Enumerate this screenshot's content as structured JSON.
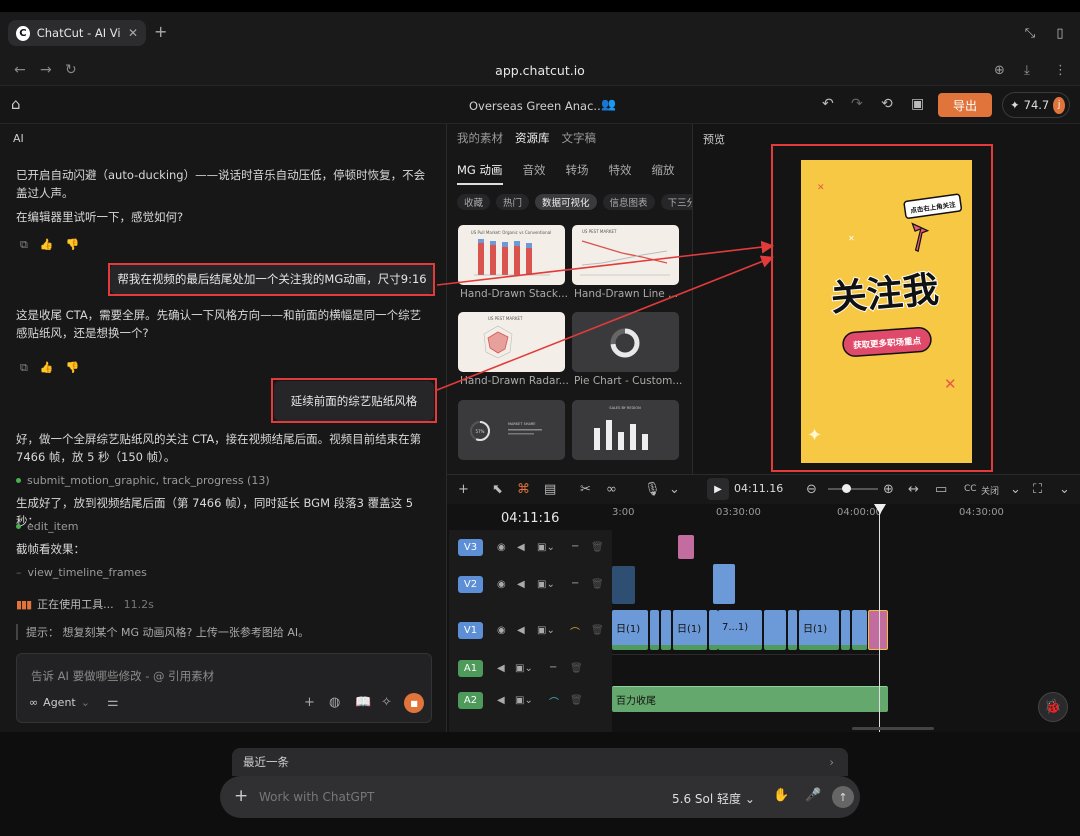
{
  "browser": {
    "tab_title": "ChatCut - AI Vi",
    "tab_favicon": "C",
    "url": "app.chatcut.io"
  },
  "header": {
    "project_name": "Overseas Green Anac...",
    "export_label": "导出",
    "credits": "74.7",
    "avatar_initial": "j"
  },
  "chat": {
    "panel_label": "AI",
    "msg1": "已开启自动闪避（auto-ducking）——说话时音乐自动压低，停顿时恢复，不会盖过人声。",
    "msg2": "在编辑器里试听一下，感觉如何?",
    "user1": "帮我在视频的最后结尾处加一个关注我的MG动画，尺寸9:16",
    "msg3": "这是收尾 CTA，需要全屏。先确认一下风格方向——和前面的横幅是同一个综艺感贴纸风，还是想换一个?",
    "user2": "延续前面的综艺贴纸风格",
    "msg4": "好，做一个全屏综艺贴纸风的关注 CTA，接在视频结尾后面。视频目前结束在第 7466 帧，放 5 秒（150 帧）。",
    "tool1": "submit_motion_graphic, track_progress (13)",
    "msg5": "生成好了，放到视频结尾后面（第 7466 帧），同时延长 BGM 段落3 覆盖这 5 秒：",
    "tool2": "edit_item",
    "msg6": "截帧看效果：",
    "tool3": "view_timeline_frames",
    "working": "正在使用工具...",
    "working_time": "11.2s",
    "tip": "提示：  想复刻某个 MG 动画风格? 上传一张参考图给 AI。",
    "input_placeholder": "告诉 AI 要做哪些修改 - @ 引用素材",
    "agent_label": "Agent"
  },
  "assets": {
    "tabs": [
      "我的素材",
      "资源库",
      "文字稿"
    ],
    "categories": [
      "MG 动画",
      "音效",
      "转场",
      "特效",
      "缩放"
    ],
    "chips": [
      "收藏",
      "热门",
      "数据可视化",
      "信息图表",
      "下三分"
    ],
    "items": [
      {
        "label": "Hand-Drawn Stack...",
        "thumb_title": "US Pull Market: Organic vs Conventional"
      },
      {
        "label": "Hand-Drawn Line ...",
        "thumb_title": "US PEST MARKET"
      },
      {
        "label": "Hand-Drawn Radar...",
        "thumb_title": "US PEST MARKET"
      },
      {
        "label": "Pie Chart - Custom...",
        "thumb_title": ""
      },
      {
        "label": "",
        "thumb_title": "MARKET SHARE"
      },
      {
        "label": "",
        "thumb_title": "SALES BY REGION"
      }
    ],
    "ring_value": "57%"
  },
  "preview": {
    "label": "预览",
    "sticker_top": "点击右上角关注",
    "headline": "关注我",
    "cta": "获取更多职场重点"
  },
  "timeline": {
    "toolbar_timecode": "04:11.16",
    "caption_toggle": "关闭",
    "caption_icon": "CC",
    "timecode": "04:11:16",
    "ruler": [
      "3:00",
      "03:30:00",
      "04:00:00",
      "04:30:00"
    ],
    "tracks": [
      "V3",
      "V2",
      "V1",
      "A1",
      "A2"
    ],
    "clips_v1": [
      "日(1)",
      "日(1)",
      "7...1)",
      "日(1)"
    ],
    "audio_clip": "百力收尾"
  },
  "gpt": {
    "recent": "最近一条",
    "placeholder": "Work with ChatGPT",
    "model": "5.6 Sol 轻度"
  },
  "colors": {
    "accent": "#e0743a",
    "highlight": "#e23b3b",
    "preview_bg": "#f7c843",
    "video_track": "#5c8fd6",
    "audio_track": "#4e9a5a"
  }
}
